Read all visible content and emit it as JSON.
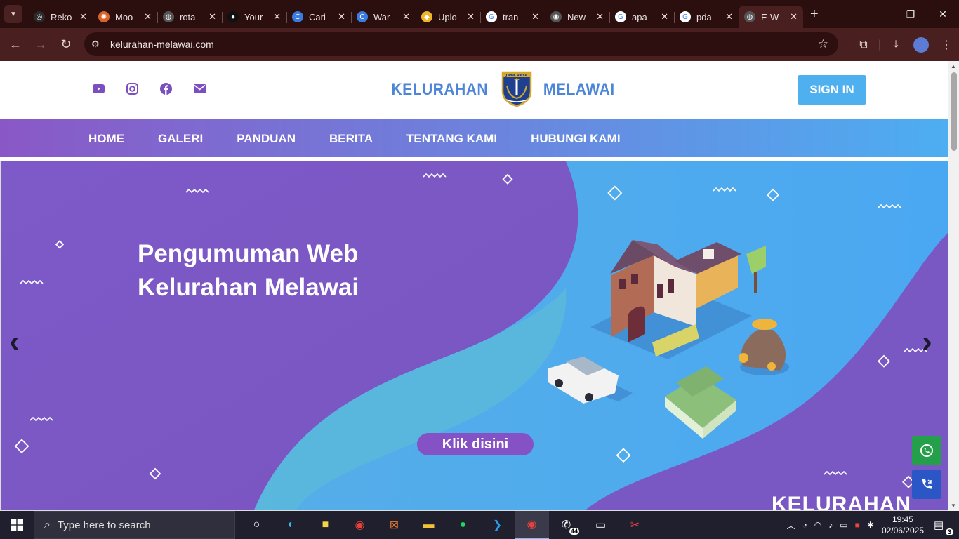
{
  "browser": {
    "tabs": [
      {
        "label": "Reko",
        "fav_color": "#2b2b2b",
        "fav_glyph": "◎"
      },
      {
        "label": "Moo",
        "fav_color": "#d9642b",
        "fav_glyph": "✺"
      },
      {
        "label": "rota",
        "fav_color": "#555555",
        "fav_glyph": "◍"
      },
      {
        "label": "Your",
        "fav_color": "#111111",
        "fav_glyph": "●"
      },
      {
        "label": "Cari",
        "fav_color": "#3b7be0",
        "fav_glyph": "C"
      },
      {
        "label": "War",
        "fav_color": "#3b7be0",
        "fav_glyph": "C"
      },
      {
        "label": "Uplo",
        "fav_color": "#f0b429",
        "fav_glyph": "◆"
      },
      {
        "label": "tran",
        "fav_color": "#ffffff",
        "fav_glyph": "G"
      },
      {
        "label": "New",
        "fav_color": "#555555",
        "fav_glyph": "◉"
      },
      {
        "label": "apa",
        "fav_color": "#ffffff",
        "fav_glyph": "G"
      },
      {
        "label": "pda",
        "fav_color": "#ffffff",
        "fav_glyph": "G"
      },
      {
        "label": "E-W",
        "fav_color": "#555555",
        "fav_glyph": "◍",
        "active": true
      }
    ],
    "address": "kelurahan-melawai.com"
  },
  "header": {
    "social": [
      "youtube-icon",
      "instagram-icon",
      "facebook-icon",
      "mail-icon"
    ],
    "logo_left": "KELURAHAN",
    "logo_right": "MELAWAI",
    "seal_text": "JAYA RAYA",
    "signin": "SIGN IN"
  },
  "nav": {
    "items": [
      "HOME",
      "GALERI",
      "PANDUAN",
      "BERITA",
      "TENTANG KAMI",
      "HUBUNGI KAMI"
    ]
  },
  "hero": {
    "title_line1": "Pengumuman Web",
    "title_line2": "Kelurahan Melawai",
    "cta": "Klik disini",
    "footer_logo_text": "KELURAHAN",
    "colors": {
      "purple": "#7e56c2",
      "blue": "#4aaaf0",
      "teal": "#5bb7dd"
    }
  },
  "taskbar": {
    "search_placeholder": "Type here to search",
    "whatsapp_badge": "44",
    "time": "19:45",
    "date": "02/06/2025",
    "notifications": "3"
  }
}
